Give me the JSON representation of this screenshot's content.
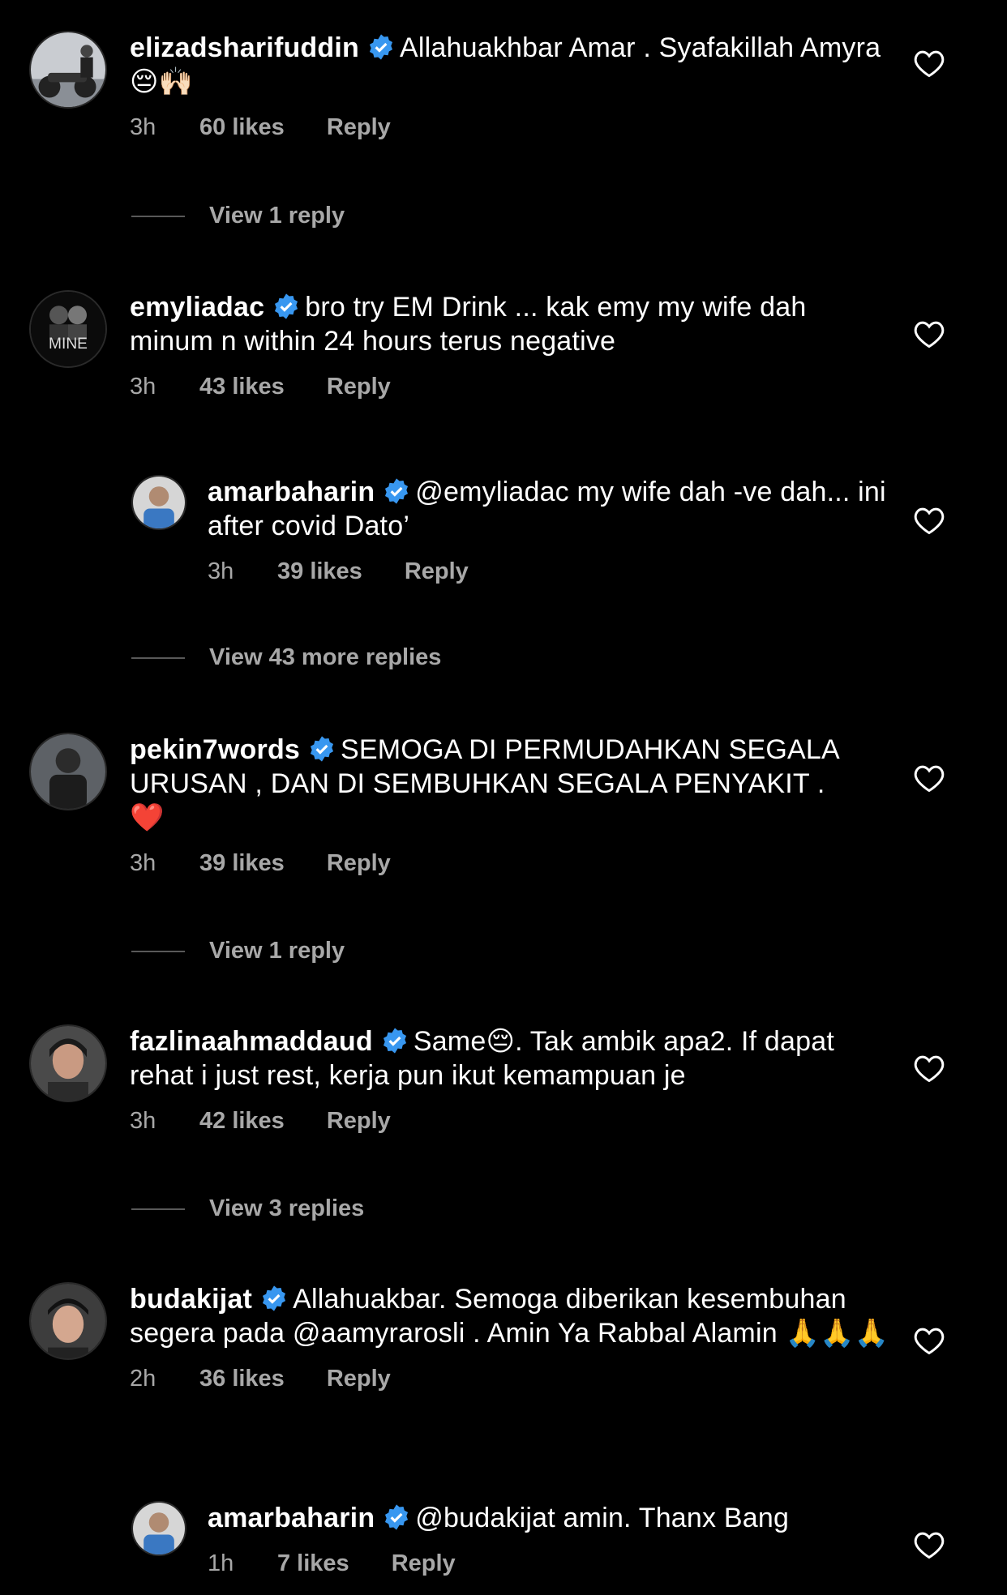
{
  "icons": {
    "verified": "verified-badge-icon",
    "heart": "heart-outline-icon"
  },
  "colors": {
    "background": "#000000",
    "text": "#ffffff",
    "secondary": "#a8a8a8",
    "verified": "#3897f0"
  },
  "comments": [
    {
      "username": "elizadsharifuddin",
      "text": "Allahuakhbar Amar . Syafakillah Amyra",
      "emoji": "😔🙌🏻",
      "time": "3h",
      "likes": "60 likes",
      "reply_label": "Reply",
      "view_replies": "View 1 reply"
    },
    {
      "username": "emyliadac",
      "text": "bro try EM Drink ... kak emy my wife dah minum n within 24 hours terus negative",
      "time": "3h",
      "likes": "43 likes",
      "reply_label": "Reply",
      "avatar_text": "MINE",
      "reply": {
        "username": "amarbaharin",
        "text": "@emyliadac my wife dah -ve dah... ini after covid Dato’",
        "time": "3h",
        "likes": "39 likes",
        "reply_label": "Reply"
      },
      "view_replies": "View 43 more replies"
    },
    {
      "username": "pekin7words",
      "text": "SEMOGA DI PERMUDAHKAN SEGALA URUSAN , DAN DI SEMBUHKAN SEGALA PENYAKIT .",
      "emoji": "❤️",
      "time": "3h",
      "likes": "39 likes",
      "reply_label": "Reply",
      "view_replies": "View 1 reply"
    },
    {
      "username": "fazlinaahmaddaud",
      "text_a": "Same",
      "emoji": "😔",
      "text_b": ". Tak ambik apa2. If dapat rehat i just rest, kerja pun ikut kemampuan je",
      "time": "3h",
      "likes": "42 likes",
      "reply_label": "Reply",
      "view_replies": "View 3 replies"
    },
    {
      "username": "budakijat",
      "text": "Allahuakbar. Semoga diberikan kesembuhan segera pada @aamyrarosli . Amin Ya Rabbal Alamin",
      "emoji": "🙏🙏🙏",
      "time": "2h",
      "likes": "36 likes",
      "reply_label": "Reply",
      "reply": {
        "username": "amarbaharin",
        "text": "@budakijat amin. Thanx Bang",
        "time": "1h",
        "likes": "7 likes",
        "reply_label": "Reply"
      }
    }
  ]
}
